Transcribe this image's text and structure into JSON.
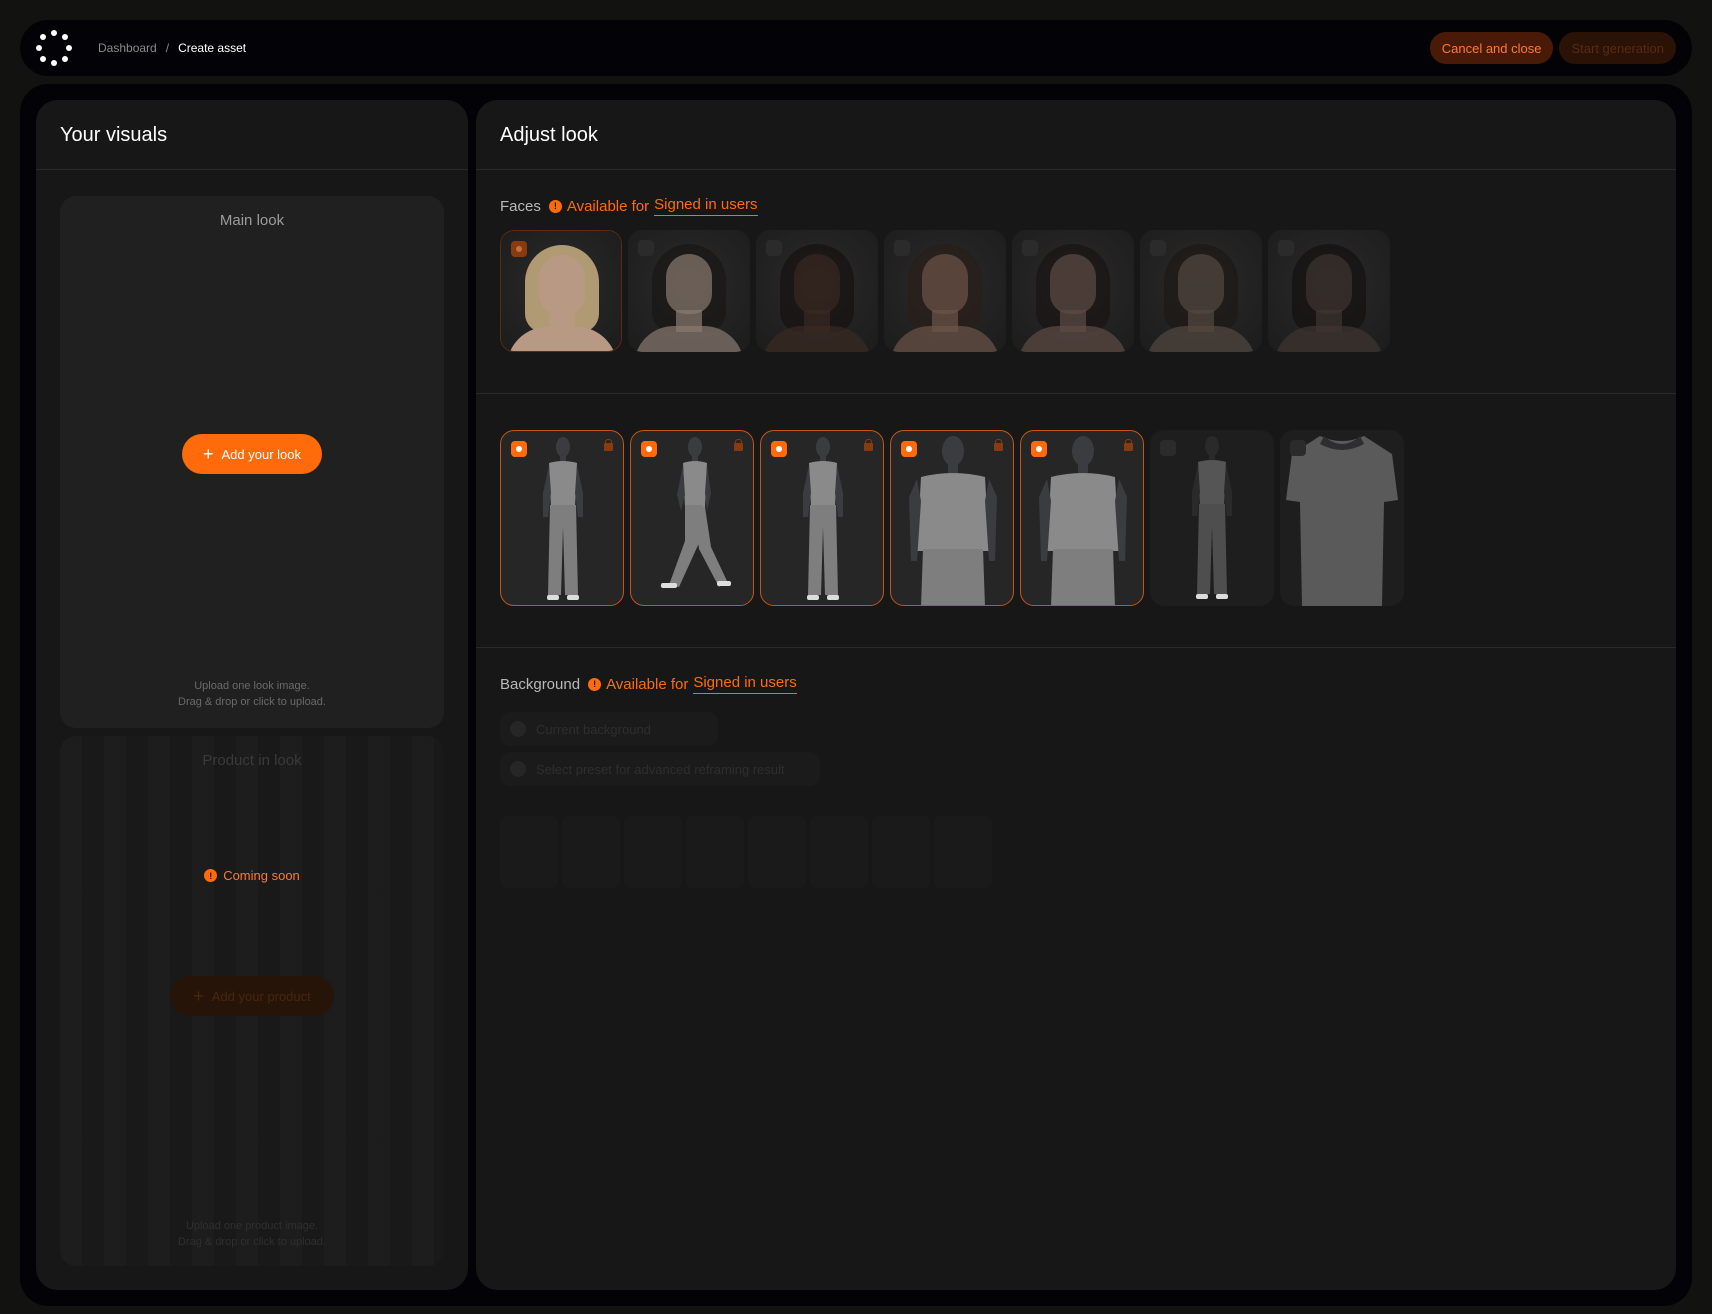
{
  "breadcrumb": {
    "parent": "Dashboard",
    "separator": "/",
    "current": "Create asset"
  },
  "actions": {
    "cancel_label": "Cancel and close",
    "start_label": "Start generation"
  },
  "left": {
    "title": "Your visuals",
    "main_look": {
      "title": "Main look",
      "button_label": "Add your look",
      "hint_line1": "Upload one look image.",
      "hint_line2": "Drag & drop or click to upload."
    },
    "product_look": {
      "title": "Product in look",
      "status": "Coming soon",
      "button_label": "Add your product",
      "hint_line1": "Upload one product image.",
      "hint_line2": "Drag & drop or click to upload."
    }
  },
  "right": {
    "title": "Adjust look",
    "faces": {
      "label": "Faces",
      "available_prefix": "Available for",
      "available_link": "Signed in users",
      "items": [
        {
          "id": "face-1",
          "selected": true,
          "skin": "#b89a84",
          "hair": "#b09a74"
        },
        {
          "id": "face-2",
          "selected": false,
          "skin": "#8a7a70",
          "hair": "#1a1716"
        },
        {
          "id": "face-3",
          "selected": false,
          "skin": "#3a2a22",
          "hair": "#151110"
        },
        {
          "id": "face-4",
          "selected": false,
          "skin": "#6c5448",
          "hair": "#2a1e18"
        },
        {
          "id": "face-5",
          "selected": false,
          "skin": "#5e4c44",
          "hair": "#1a1412"
        },
        {
          "id": "face-6",
          "selected": false,
          "skin": "#524840",
          "hair": "#1c1816"
        },
        {
          "id": "face-7",
          "selected": false,
          "skin": "#3e3430",
          "hair": "#141110"
        }
      ]
    },
    "poses": {
      "items": [
        {
          "id": "pose-front",
          "selected": true,
          "locked": true,
          "kind": "full"
        },
        {
          "id": "pose-walk",
          "selected": true,
          "locked": true,
          "kind": "walk"
        },
        {
          "id": "pose-back",
          "selected": true,
          "locked": true,
          "kind": "full"
        },
        {
          "id": "pose-half-front",
          "selected": true,
          "locked": true,
          "kind": "half"
        },
        {
          "id": "pose-half-back",
          "selected": true,
          "locked": true,
          "kind": "half"
        },
        {
          "id": "pose-side",
          "selected": false,
          "locked": false,
          "kind": "full"
        },
        {
          "id": "pose-tshirt",
          "selected": false,
          "locked": false,
          "kind": "shirt"
        }
      ]
    },
    "background": {
      "label": "Background",
      "available_prefix": "Available for",
      "available_link": "Signed in users",
      "options": [
        {
          "label": "Current background"
        },
        {
          "label": "Select preset for advanced reframing result"
        }
      ]
    }
  },
  "colors": {
    "accent": "#ff6b0a",
    "surface": "#171717",
    "frame": "#030307"
  }
}
